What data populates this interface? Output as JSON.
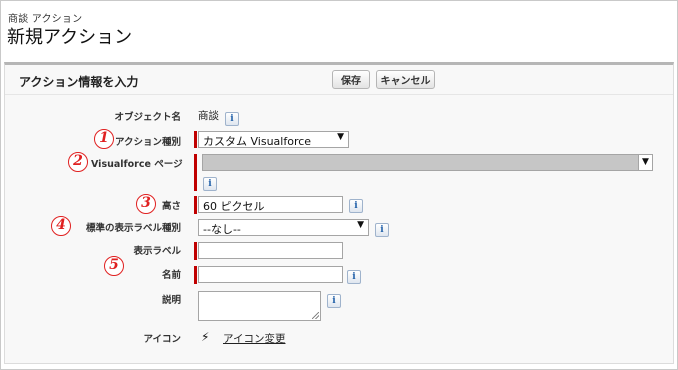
{
  "header": {
    "object_label": "商談 アクション",
    "page_title": "新規アクション"
  },
  "panel": {
    "title": "アクション情報を入力",
    "save_label": "保存",
    "cancel_label": "キャンセル"
  },
  "form": {
    "object_name": {
      "label": "オブジェクト名",
      "value": "商談"
    },
    "action_type": {
      "label": "アクション種別",
      "value": "カスタム Visualforce"
    },
    "vf_page": {
      "label": "Visualforce ページ",
      "value": ""
    },
    "height": {
      "label": "高さ",
      "value": "60 ピクセル"
    },
    "std_label_type": {
      "label": "標準の表示ラベル種別",
      "value": "--なし--"
    },
    "display_label": {
      "label": "表示ラベル",
      "value": ""
    },
    "name": {
      "label": "名前",
      "value": ""
    },
    "description": {
      "label": "説明",
      "value": ""
    },
    "icon": {
      "label": "アイコン",
      "link": "アイコン変更",
      "icon_name": "lightning-bolt-icon"
    }
  },
  "callouts": [
    "1",
    "2",
    "3",
    "4",
    "5"
  ],
  "colors": {
    "required": "#c00000",
    "callout": "#e02020",
    "info": "#1f5fa8"
  }
}
